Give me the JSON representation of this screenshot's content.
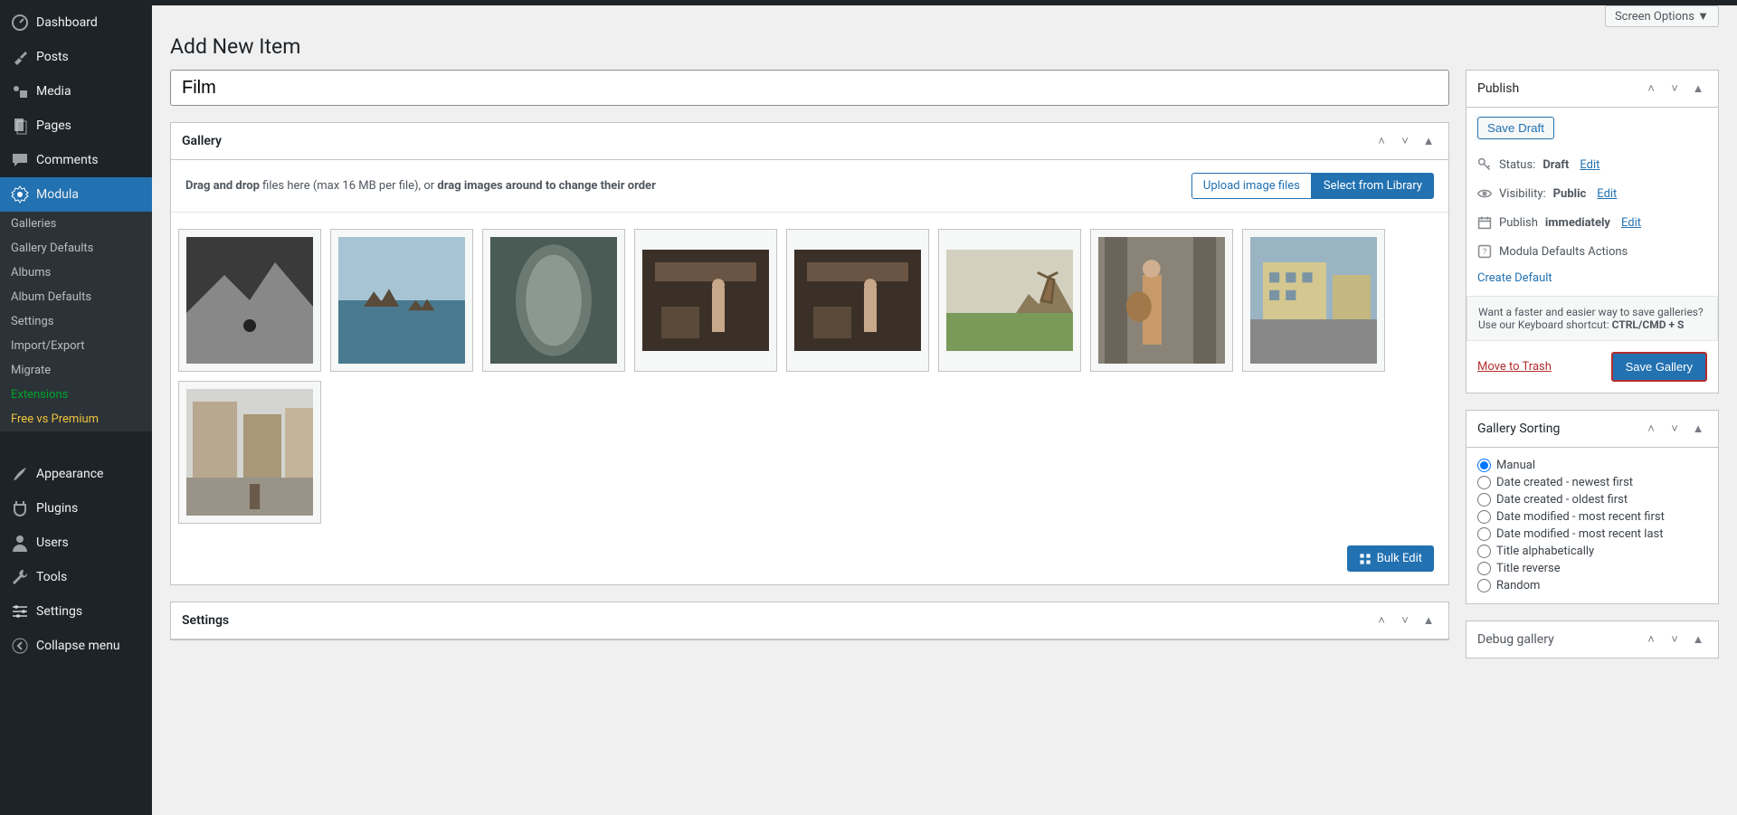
{
  "screen_options": "Screen Options ▼",
  "page_title": "Add New Item",
  "title_value": "Film",
  "sidebar": {
    "items": [
      {
        "label": "Dashboard"
      },
      {
        "label": "Posts"
      },
      {
        "label": "Media"
      },
      {
        "label": "Pages"
      },
      {
        "label": "Comments"
      },
      {
        "label": "Modula"
      }
    ],
    "sub": [
      {
        "label": "Galleries"
      },
      {
        "label": "Gallery Defaults"
      },
      {
        "label": "Albums"
      },
      {
        "label": "Album Defaults"
      },
      {
        "label": "Settings"
      },
      {
        "label": "Import/Export"
      },
      {
        "label": "Migrate"
      },
      {
        "label": "Extensions"
      },
      {
        "label": "Free vs Premium"
      }
    ],
    "bottom": [
      {
        "label": "Appearance"
      },
      {
        "label": "Plugins"
      },
      {
        "label": "Users"
      },
      {
        "label": "Tools"
      },
      {
        "label": "Settings"
      },
      {
        "label": "Collapse menu"
      }
    ]
  },
  "gallery": {
    "title": "Gallery",
    "hint_prefix": "Drag and drop",
    "hint_mid": " files here (max 16 MB per file), or ",
    "hint_bold": "drag images around to change their order",
    "upload": "Upload image files",
    "select": "Select from Library",
    "bulk_edit": "Bulk Edit"
  },
  "publish": {
    "title": "Publish",
    "save_draft": "Save Draft",
    "status_label": "Status:",
    "status_value": "Draft",
    "visibility_label": "Visibility:",
    "visibility_value": "Public",
    "publish_label": "Publish",
    "publish_value": "immediately",
    "edit": "Edit",
    "defaults_actions": "Modula Defaults Actions",
    "create_default": "Create Default",
    "shortcut_text": "Want a faster and easier way to save galleries? Use our Keyboard shortcut: ",
    "shortcut_key": "CTRL/CMD + S",
    "trash": "Move to Trash",
    "save": "Save Gallery"
  },
  "sorting": {
    "title": "Gallery Sorting",
    "options": [
      "Manual",
      "Date created - newest first",
      "Date created - oldest first",
      "Date modified - most recent first",
      "Date modified - most recent last",
      "Title alphabetically",
      "Title reverse",
      "Random"
    ]
  },
  "settings_title": "Settings",
  "debug_title": "Debug gallery"
}
